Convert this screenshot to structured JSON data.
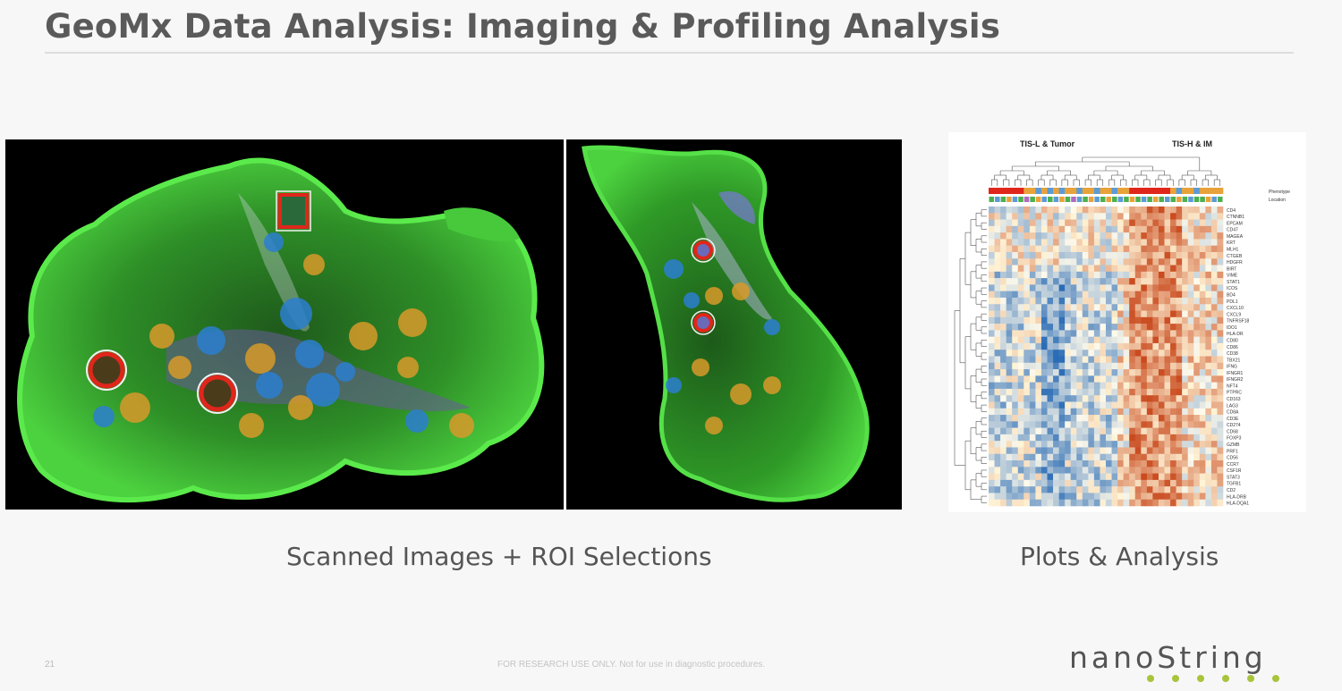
{
  "slide": {
    "title": "GeoMx Data Analysis: Imaging & Profiling Analysis",
    "page_number": "21",
    "footer_note": "FOR RESEARCH USE ONLY. Not for use in diagnostic procedures.",
    "logo_text": "nanoString"
  },
  "images": {
    "scan_left_name": "tissue-scan-1",
    "scan_right_name": "tissue-scan-2"
  },
  "heatmap": {
    "group_labels": [
      "TIS-L & Tumor",
      "TIS-H & IM"
    ],
    "legend": [
      "Phenotype",
      "Location"
    ],
    "gene_labels": [
      "CD4",
      "CTNNB1",
      "EPCAM",
      "CD47",
      "MAGEA",
      "KRT",
      "MLH1",
      "CTGEB",
      "HDGFR",
      "BIRT",
      "VIME",
      "STAT1",
      "ICOS",
      "BD4",
      "PDL1",
      "CXCL10",
      "CXCL9",
      "TNFRSF18",
      "IDO1",
      "HLA-DR",
      "CD80",
      "CD86",
      "CD38",
      "TBX21",
      "IFNG",
      "IFNGR1",
      "IFNGR2",
      "NFT4",
      "PTPRC",
      "CD163",
      "LAG3",
      "CD8A",
      "CD3E",
      "CD274",
      "CD68",
      "FOXP3",
      "GZMB",
      "PRF1",
      "CD56",
      "CCR7",
      "CSF1R",
      "STAT3",
      "TGFB1",
      "CD2",
      "HLA-DRB",
      "HLA-DQA1"
    ]
  },
  "captions": {
    "left": "Scanned Images + ROI Selections",
    "right": "Plots & Analysis"
  },
  "colors": {
    "tissue": "#2fae2a",
    "roi_orange": "#d89a2a",
    "roi_blue": "#2c7fd0",
    "roi_highlight": "#e0261b",
    "heat_high": "#c94a1e",
    "heat_low": "#2b6cb5",
    "logo_dots": "#a7c43b"
  }
}
